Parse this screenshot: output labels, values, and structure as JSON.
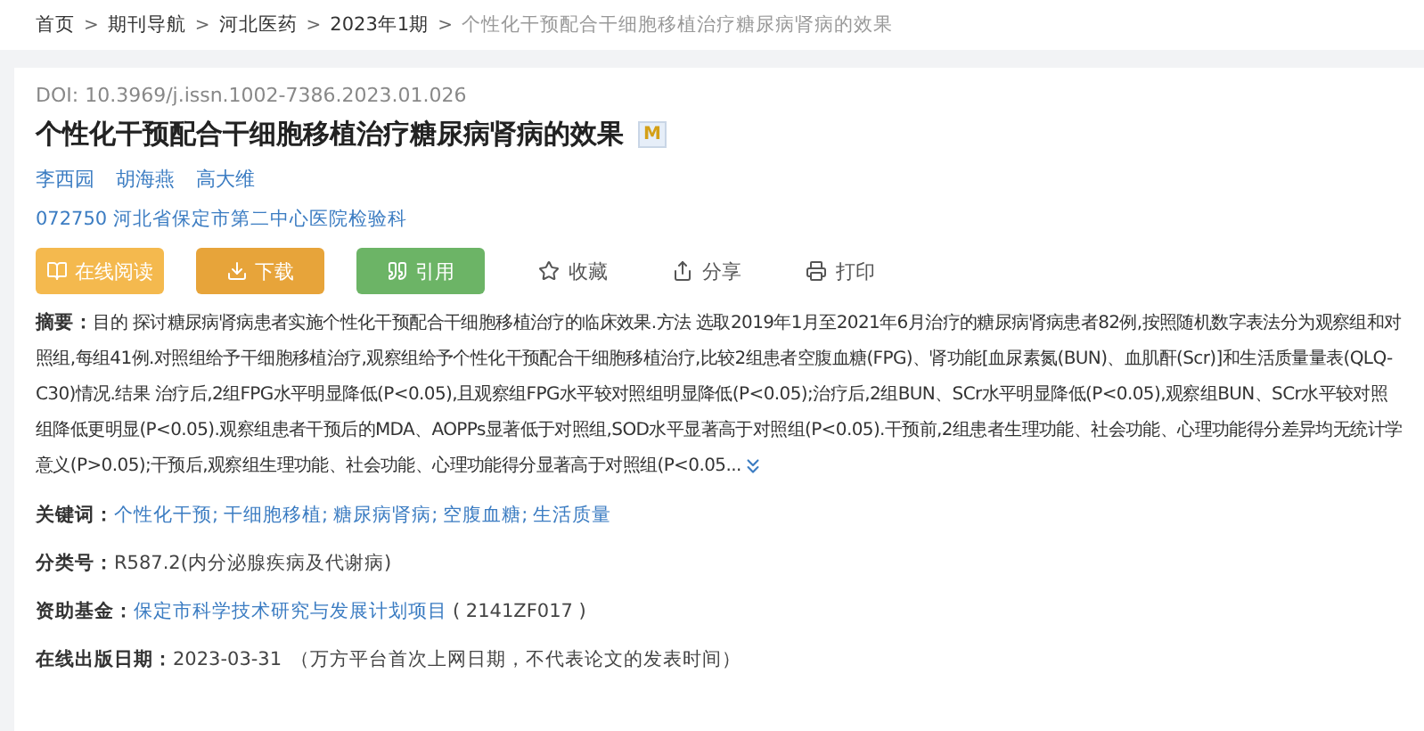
{
  "breadcrumb": [
    {
      "label": "首页",
      "current": false
    },
    {
      "label": "期刊导航",
      "current": false
    },
    {
      "label": "河北医药",
      "current": false
    },
    {
      "label": "2023年1期",
      "current": false
    },
    {
      "label": "个性化干预配合干细胞移植治疗糖尿病肾病的效果",
      "current": true
    }
  ],
  "separator": ">",
  "doi": "DOI: 10.3969/j.issn.1002-7386.2023.01.026",
  "title": "个性化干预配合干细胞移植治疗糖尿病肾病的效果",
  "title_badge": "M",
  "authors": [
    "李西园",
    "胡海燕",
    "高大维"
  ],
  "affiliation": "072750 河北省保定市第二中心医院检验科",
  "buttons": [
    {
      "label": "在线阅读",
      "kind": "read"
    },
    {
      "label": "下载",
      "kind": "download"
    },
    {
      "label": "引用",
      "kind": "cite"
    }
  ],
  "actions": [
    {
      "label": "收藏",
      "kind": "star"
    },
    {
      "label": "分享",
      "kind": "share"
    },
    {
      "label": "打印",
      "kind": "print"
    }
  ],
  "abstract": {
    "label": "摘要：",
    "text": "目的 探讨糖尿病肾病患者实施个性化干预配合干细胞移植治疗的临床效果.方法 选取2019年1月至2021年6月治疗的糖尿病肾病患者82例,按照随机数字表法分为观察组和对照组,每组41例.对照组给予干细胞移植治疗,观察组给予个性化干预配合干细胞移植治疗,比较2组患者空腹血糖(FPG)、肾功能[血尿素氮(BUN)、血肌酐(Scr)]和生活质量量表(QLQ-C30)情况.结果 治疗后,2组FPG水平明显降低(P<0.05),且观察组FPG水平较对照组明显降低(P<0.05);治疗后,2组BUN、SCr水平明显降低(P<0.05),观察组BUN、SCr水平较对照组降低更明显(P<0.05).观察组患者干预后的MDA、AOPPs显著低于对照组,SOD水平显著高于对照组(P<0.05).干预前,2组患者生理功能、社会功能、心理功能得分差异均无统计学意义(P>0.05);干预后,观察组生理功能、社会功能、心理功能得分显著高于对照组(P<0.05...",
    "expanded": false
  },
  "keywords": {
    "label": "关键词：",
    "items": [
      "个性化干预;",
      "干细胞移植;",
      "糖尿病肾病;",
      "空腹血糖;",
      "生活质量"
    ]
  },
  "classification": {
    "label": "分类号：",
    "value": "R587.2(内分泌腺疾病及代谢病)"
  },
  "fund": {
    "label": "资助基金：",
    "link": "保定市科学技术研究与发展计划项目",
    "code": "( 2141ZF017 )"
  },
  "online_date": {
    "label": "在线出版日期：",
    "value": "2023-03-31",
    "note": "（万方平台首次上网日期，不代表论文的发表时间）"
  }
}
